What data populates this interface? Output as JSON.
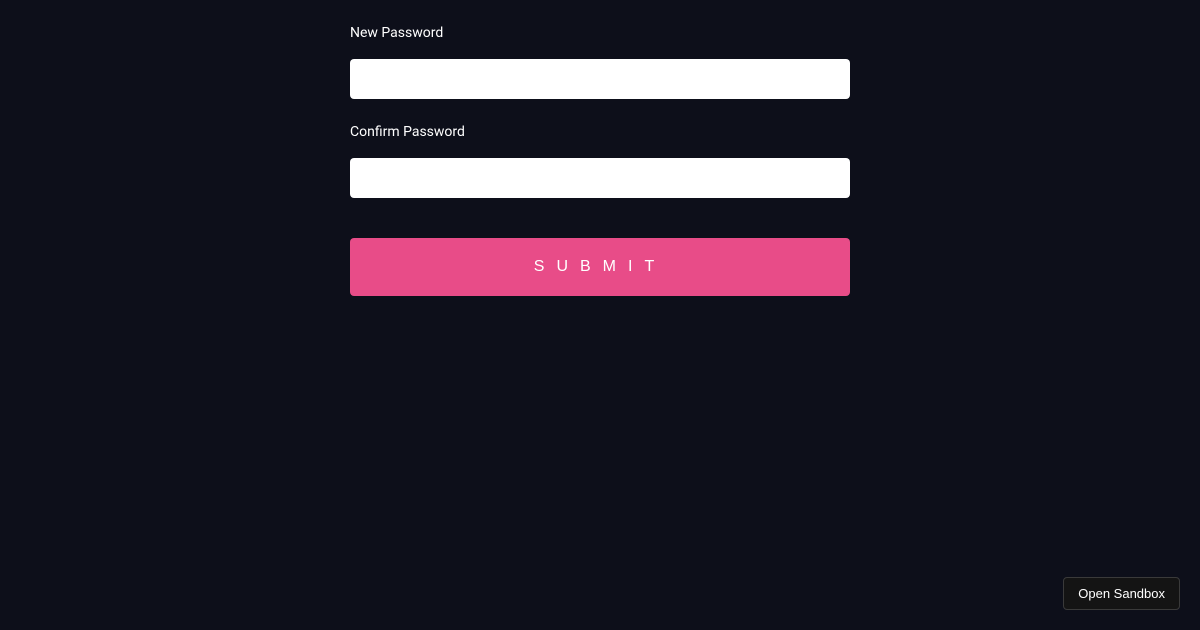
{
  "form": {
    "fields": {
      "newPassword": {
        "label": "New Password",
        "value": ""
      },
      "confirmPassword": {
        "label": "Confirm Password",
        "value": ""
      }
    },
    "submit": {
      "label": "Submit"
    }
  },
  "sandbox": {
    "button_label": "Open Sandbox"
  },
  "colors": {
    "background": "#0d0f1a",
    "accent": "#e84c88",
    "input_bg": "#ffffff",
    "text": "#ffffff"
  }
}
